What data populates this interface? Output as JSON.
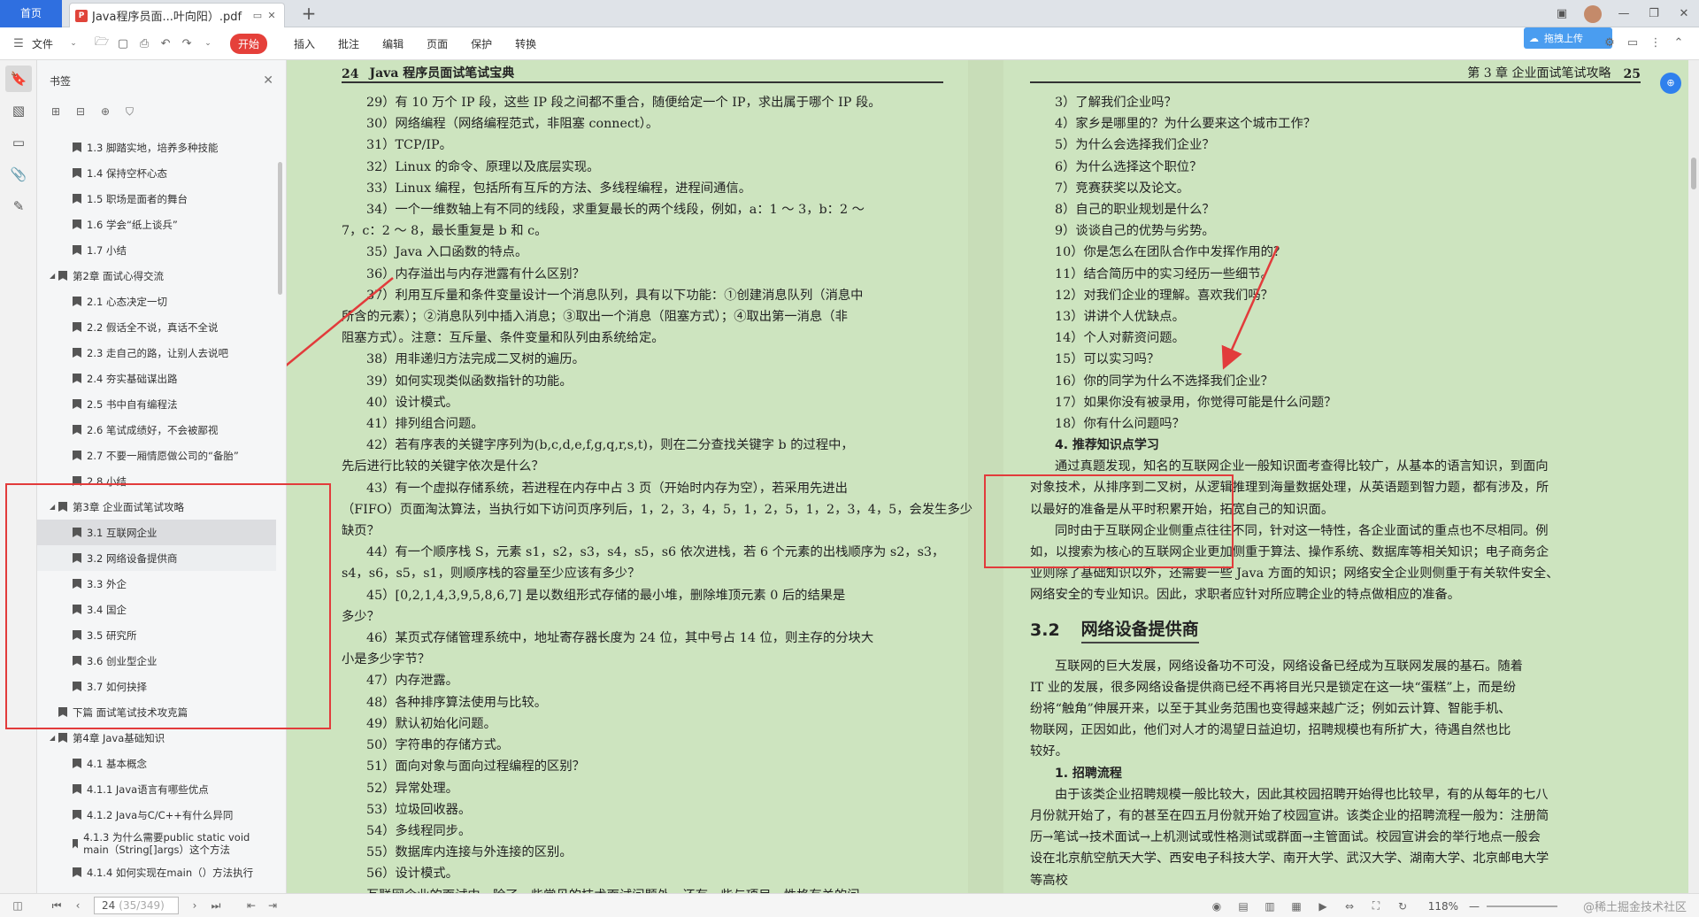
{
  "tabs": {
    "home": "首页",
    "doc": "Java程序员面...叶向阳）.pdf",
    "new": "+"
  },
  "toolbar": {
    "file": "文件",
    "start": "开始",
    "menus": [
      "插入",
      "批注",
      "编辑",
      "页面",
      "保护",
      "转换"
    ],
    "upload": "拖拽上传"
  },
  "bookmarks": {
    "title": "书签",
    "items": [
      {
        "level": 2,
        "text": "1.3 脚踏实地，培养多种技能"
      },
      {
        "level": 2,
        "text": "1.4 保持空杯心态"
      },
      {
        "level": 2,
        "text": "1.5 职场是面者的舞台"
      },
      {
        "level": 2,
        "text": "1.6 学会“纸上谈兵”"
      },
      {
        "level": 2,
        "text": "1.7 小结"
      },
      {
        "level": 1,
        "text": "第2章 面试心得交流"
      },
      {
        "level": 2,
        "text": "2.1 心态决定一切"
      },
      {
        "level": 2,
        "text": "2.2 假话全不说，真话不全说"
      },
      {
        "level": 2,
        "text": "2.3 走自己的路，让别人去说吧"
      },
      {
        "level": 2,
        "text": "2.4 夯实基础谋出路"
      },
      {
        "level": 2,
        "text": "2.5 书中自有编程法"
      },
      {
        "level": 2,
        "text": "2.6 笔试成绩好，不会被鄙视"
      },
      {
        "level": 2,
        "text": "2.7 不要一厢情愿做公司的“备胎”"
      },
      {
        "level": 2,
        "text": "2.8 小结"
      },
      {
        "level": 1,
        "text": "第3章 企业面试笔试攻略"
      },
      {
        "level": 2,
        "text": "3.1 互联网企业",
        "state": "selected"
      },
      {
        "level": 2,
        "text": "3.2 网络设备提供商",
        "state": "hover"
      },
      {
        "level": 2,
        "text": "3.3 外企"
      },
      {
        "level": 2,
        "text": "3.4 国企"
      },
      {
        "level": 2,
        "text": "3.5 研究所"
      },
      {
        "level": 2,
        "text": "3.6 创业型企业"
      },
      {
        "level": 2,
        "text": "3.7 如何抉择"
      },
      {
        "level": 1,
        "text": "下篇 面试笔试技术攻克篇",
        "noarrow": true
      },
      {
        "level": 1,
        "text": "第4章 Java基础知识"
      },
      {
        "level": 2,
        "text": "4.1 基本概念"
      },
      {
        "level": 2,
        "text": "4.1.1 Java语言有哪些优点"
      },
      {
        "level": 2,
        "text": "4.1.2 Java与C/C++有什么异同"
      },
      {
        "level": 2,
        "text": "4.1.3 为什么需要public static void main（String[]args）这个方法"
      },
      {
        "level": 2,
        "text": "4.1.4 如何实现在main（）方法执行"
      }
    ]
  },
  "left_page": {
    "header_num": "24",
    "header_title": "Java 程序员面试笔试宝典",
    "lines": [
      "29）有 10 万个 IP 段，这些 IP 段之间都不重合，随便给定一个 IP，求出属于哪个 IP 段。",
      "30）网络编程（网络编程范式，非阻塞 connect）。",
      "31）TCP/IP。",
      "32）Linux 的命令、原理以及底层实现。",
      "33）Linux 编程，包括所有互斥的方法、多线程编程，进程间通信。",
      "34）一个一维数轴上有不同的线段，求重复最长的两个线段，例如，a：1 ～ 3，b：2 ～",
      "7，c：2 ～ 8，最长重复是 b 和 c。",
      "35）Java 入口函数的特点。",
      "36）内存溢出与内存泄露有什么区别？",
      "37）利用互斥量和条件变量设计一个消息队列，具有以下功能：①创建消息队列（消息中",
      "所含的元素）；②消息队列中插入消息；③取出一个消息（阻塞方式）；④取出第一消息（非",
      "阻塞方式）。注意：互斥量、条件变量和队列由系统给定。",
      "38）用非递归方法完成二叉树的遍历。",
      "39）如何实现类似函数指针的功能。",
      "40）设计模式。",
      "41）排列组合问题。",
      "42）若有序表的关键字序列为(b,c,d,e,f,g,q,r,s,t)，则在二分查找关键字 b 的过程中，",
      "先后进行比较的关键字依次是什么？",
      "43）有一个虚拟存储系统，若进程在内存中占 3 页（开始时内存为空），若采用先进出",
      "（FIFO）页面淘汰算法，当执行如下访问页序列后，1，2，3，4，5，1，2，5，1，2，3，4，5，会发生多少",
      "缺页？",
      "44）有一个顺序栈 S，元素 s1，s2，s3，s4，s5，s6 依次进栈，若 6 个元素的出栈顺序为 s2，s3，",
      "s4，s6，s5，s1，则顺序栈的容量至少应该有多少？",
      "45）[0,2,1,4,3,9,5,8,6,7] 是以数组形式存储的最小堆，删除堆顶元素 0 后的结果是",
      "多少？",
      "46）某页式存储管理系统中，地址寄存器长度为 24 位，其中号占 14 位，则主存的分块大",
      "小是多少字节？",
      "47）内存泄露。",
      "48）各种排序算法使用与比较。",
      "49）默认初始化问题。",
      "50）字符串的存储方式。",
      "51）面向对象与面向过程编程的区别？",
      "52）异常处理。",
      "53）垃圾回收器。",
      "54）多线程同步。",
      "55）数据库内连接与外连接的区别。",
      "56）设计模式。",
      "互联网企业的面试中，除了一些常见的技术面试问题外，还有一些与项目、性格有关的问"
    ]
  },
  "right_page": {
    "header_chapter": "第 3 章 企业面试笔试攻略",
    "header_num": "25",
    "list": [
      "3）了解我们企业吗？",
      "4）家乡是哪里的？为什么要来这个城市工作？",
      "5）为什么会选择我们企业？",
      "6）为什么选择这个职位？",
      "7）竞赛获奖以及论文。",
      "8）自己的职业规划是什么？",
      "9）谈谈自己的优势与劣势。",
      "10）你是怎么在团队合作中发挥作用的？",
      "11）结合简历中的实习经历一些细节。",
      "12）对我们企业的理解。喜欢我们吗？",
      "13）讲讲个人优缺点。",
      "14）个人对薪资问题。",
      "15）可以实习吗？",
      "16）你的同学为什么不选择我们企业？",
      "17）如果你没有被录用，你觉得可能是什么问题？",
      "18）你有什么问题吗？"
    ],
    "sub4": "4. 推荐知识点学习",
    "para1": [
      "通过真题发现，知名的互联网企业一般知识面考查得比较广，从基本的语言知识，到面向",
      "对象技术，从排序到二叉树，从逻辑推理到海量数据处理，从英语题到智力题，都有涉及，所",
      "以最好的准备是从平时积累开始，拓宽自己的知识面。"
    ],
    "para2": [
      "同时由于互联网企业侧重点往往不同，针对这一特性，各企业面试的重点也不尽相同。例",
      "如，以搜索为核心的互联网企业更加侧重于算法、操作系统、数据库等相关知识；电子商务企",
      "业则除了基础知识以外，还需要一些 Java 方面的知识；网络安全企业则侧重于有关软件安全、",
      "网络安全的专业知识。因此，求职者应针对所应聘企业的特点做相应的准备。"
    ],
    "section_num": "3.2",
    "section_title": "网络设备提供商",
    "para3": [
      "互联网的巨大发展，网络设备功不可没，网络设备已经成为互联网发展的基石。随着",
      "IT 业的发展，很多网络设备提供商已经不再将目光只是锁定在这一块“蛋糕”上，而是纷",
      "纷将“触角”伸展开来，以至于其业务范围也变得越来越广泛；例如云计算、智能手机、",
      "物联网，正因如此，他们对人才的渴望日益迫切，招聘规模也有所扩大，待遇自然也比",
      "较好。"
    ],
    "sub1": "1. 招聘流程",
    "para4": [
      "由于该类企业招聘规模一般比较大，因此其校园招聘开始得也比较早，有的从每年的七八",
      "月份就开始了，有的甚至在四五月份就开始了校园宣讲。该类企业的招聘流程一般为：注册简",
      "历→笔试→技术面试→上机测试或性格测试或群面→主管面试。校园宣讲会的举行地点一般会",
      "设在北京航空航天大学、西安电子科技大学、南开大学、武汉大学、湖南大学、北京邮电大学",
      "等高校"
    ]
  },
  "statusbar": {
    "page_current": "24",
    "page_total": "(35/349)",
    "zoom": "118%",
    "watermark": "@稀土掘金技术社区"
  },
  "colors": {
    "page_bg": "#cde4bf",
    "annotation": "#e23b3b",
    "home_tab": "#2f6fe0",
    "start_button": "#e5403a"
  }
}
